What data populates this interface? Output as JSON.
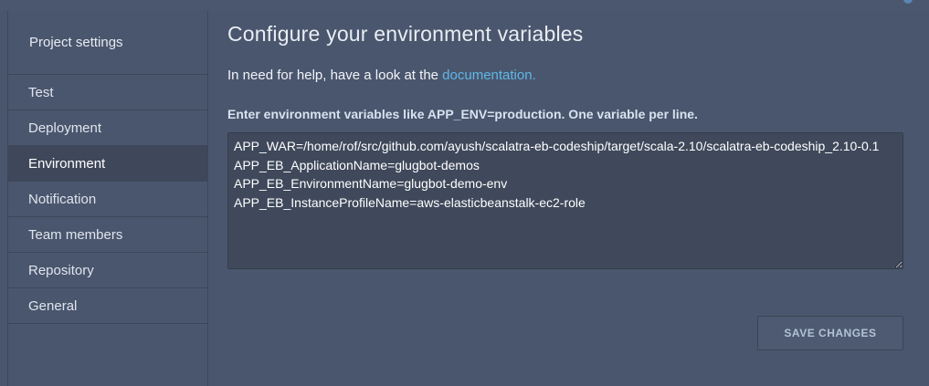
{
  "sidebar": {
    "title": "Project settings",
    "items": [
      {
        "label": "Test"
      },
      {
        "label": "Deployment"
      },
      {
        "label": "Environment"
      },
      {
        "label": "Notification"
      },
      {
        "label": "Team members"
      },
      {
        "label": "Repository"
      },
      {
        "label": "General"
      }
    ],
    "active": "Environment"
  },
  "main": {
    "title": "Configure your environment variables",
    "help_prefix": "In need for help, have a look at the ",
    "help_link": "documentation.",
    "field_label": "Enter environment variables like APP_ENV=production. One variable per line.",
    "env_value": "APP_WAR=/home/rof/src/github.com/ayush/scalatra-eb-codeship/target/scala-2.10/scalatra-eb-codeship_2.10-0.1\nAPP_EB_ApplicationName=glugbot-demos\nAPP_EB_EnvironmentName=glugbot-demo-env\nAPP_EB_InstanceProfileName=aws-elasticbeanstalk-ec2-role",
    "save_label": "SAVE CHANGES"
  },
  "colors": {
    "background": "#4a566d",
    "active_item": "#3e485a",
    "link": "#5fb8e8",
    "textarea": "#3f495b"
  }
}
